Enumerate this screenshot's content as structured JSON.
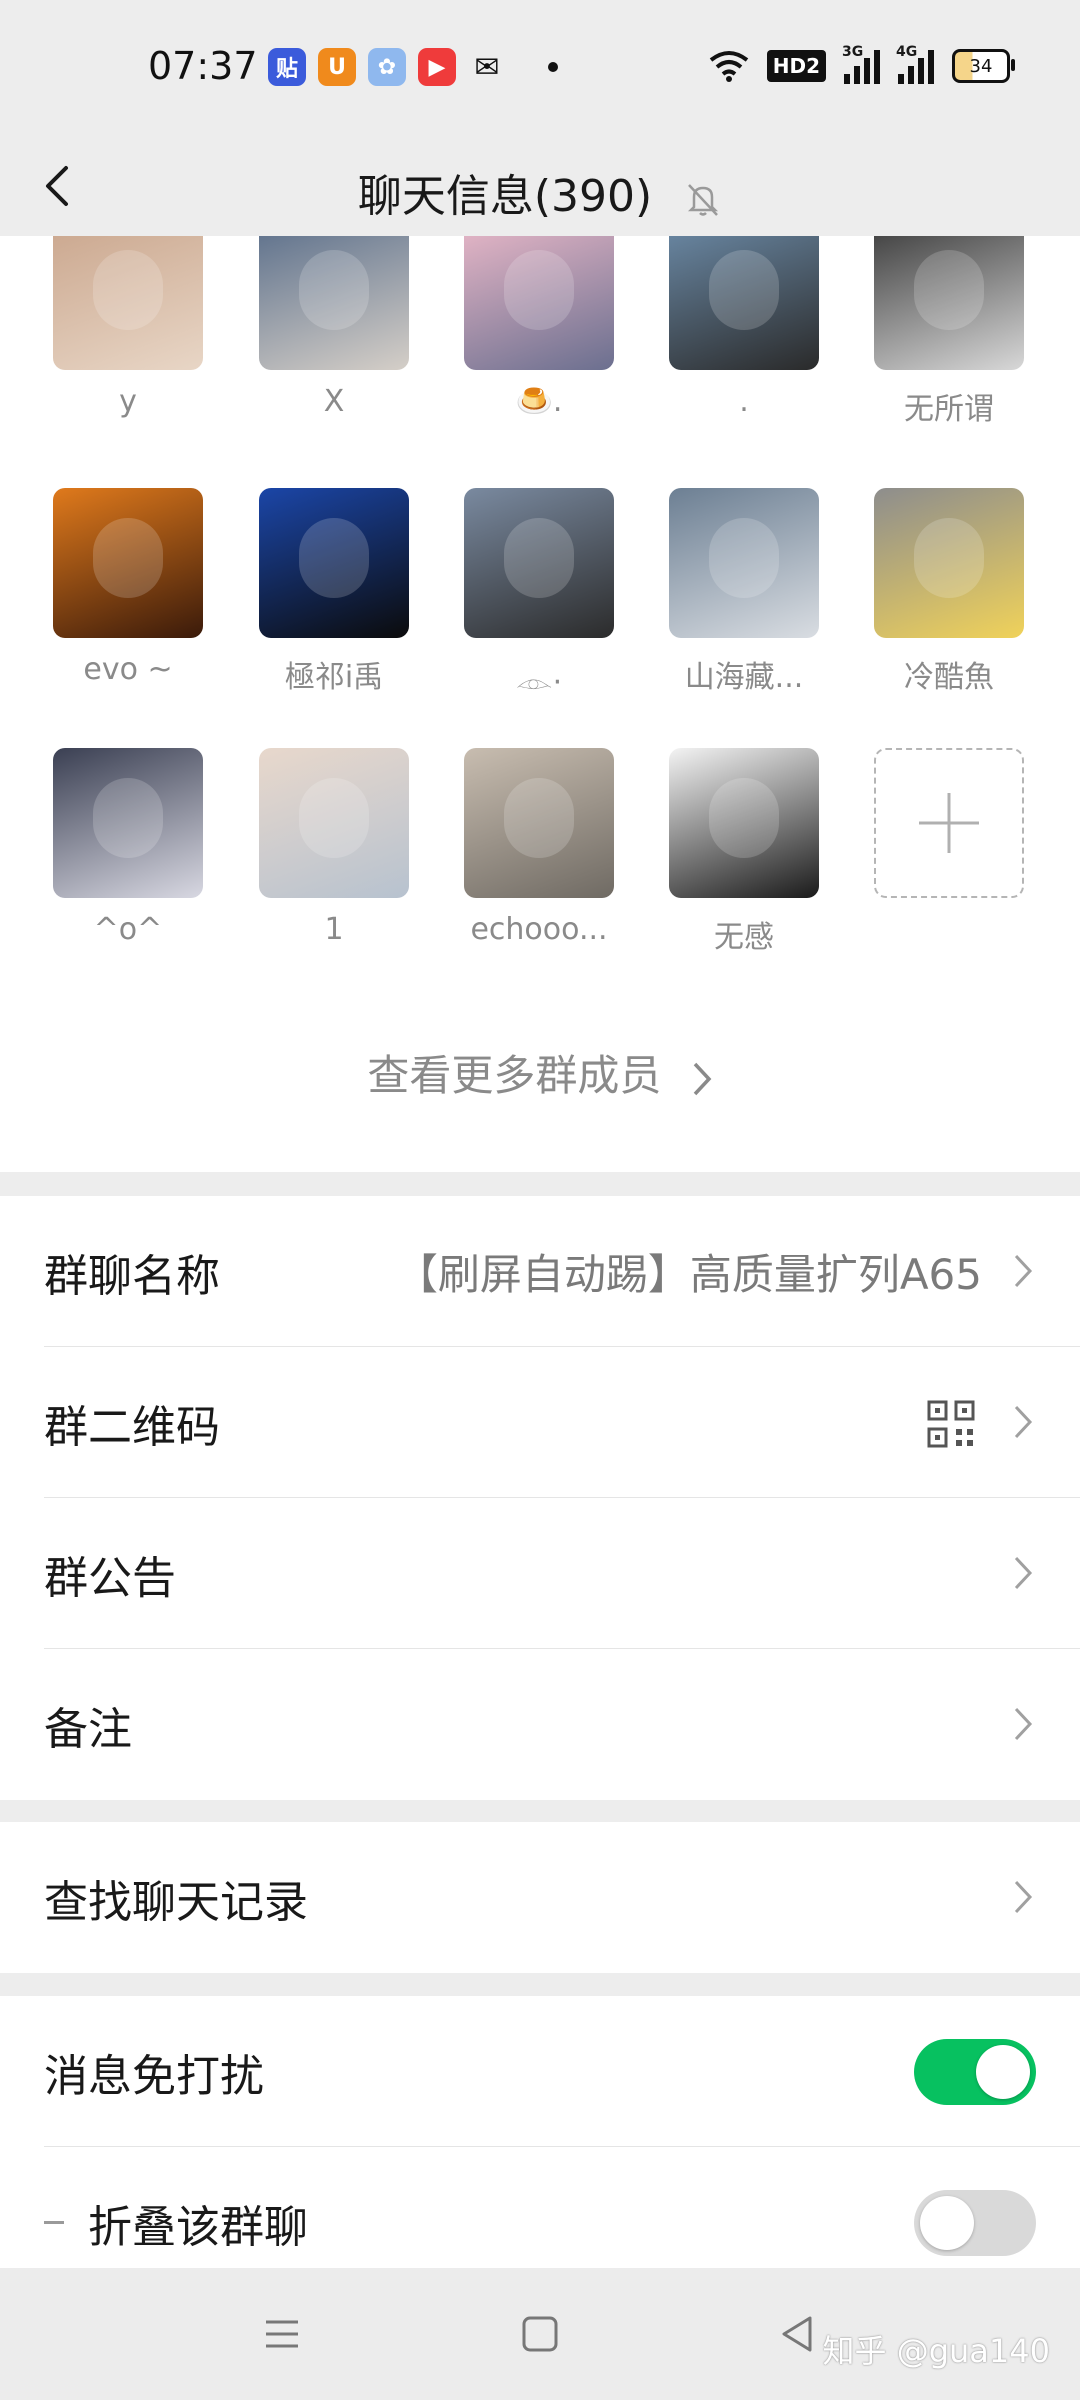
{
  "status_bar": {
    "time": "07:37",
    "hd_label": "HD2",
    "net1": "3G",
    "net2": "4G",
    "battery": "34"
  },
  "header": {
    "title": "聊天信息(390)"
  },
  "members": [
    {
      "name": "y",
      "colors": [
        "#caa68d",
        "#e8d6c6"
      ]
    },
    {
      "name": "X",
      "colors": [
        "#5a6e8a",
        "#d5cfc8"
      ]
    },
    {
      "name": "🍮.",
      "colors": [
        "#e9b8c8",
        "#6b6f8f"
      ]
    },
    {
      "name": ".",
      "colors": [
        "#6c8ba8",
        "#2a2a2a"
      ]
    },
    {
      "name": "无所谓",
      "colors": [
        "#3a3a3a",
        "#d8d8d8"
      ]
    },
    {
      "name": "evo ~",
      "colors": [
        "#e07a1c",
        "#3a1a0a"
      ]
    },
    {
      "name": "極祁i禹",
      "colors": [
        "#1b46a8",
        "#0b0b0b"
      ]
    },
    {
      "name": "𓁹·",
      "colors": [
        "#7a8aa0",
        "#2b2b2b"
      ]
    },
    {
      "name": "山海藏...",
      "colors": [
        "#6c7f93",
        "#d9dde2"
      ]
    },
    {
      "name": "冷酷魚",
      "colors": [
        "#8d8d8d",
        "#f0d25a"
      ]
    },
    {
      "name": "^o^",
      "colors": [
        "#3a3f52",
        "#d8d8e2"
      ]
    },
    {
      "name": "1",
      "colors": [
        "#e8d8cc",
        "#b7c2cf"
      ]
    },
    {
      "name": "echooo...",
      "colors": [
        "#c8bdb0",
        "#6f6a63"
      ]
    },
    {
      "name": "无感",
      "colors": [
        "#f4f4f4",
        "#1a1a1a"
      ]
    }
  ],
  "more_members_label": "查看更多群成员",
  "settings": {
    "group_name_label": "群聊名称",
    "group_name_value": "【刷屏自动踢】高质量扩列A65",
    "qr_label": "群二维码",
    "notice_label": "群公告",
    "remark_label": "备注",
    "search_label": "查找聊天记录",
    "mute_label": "消息免打扰",
    "mute_on": true,
    "fold_label": "折叠该群聊",
    "fold_on": false,
    "toggle_on_color": "#07c160"
  },
  "watermark": "知乎 @gua140"
}
